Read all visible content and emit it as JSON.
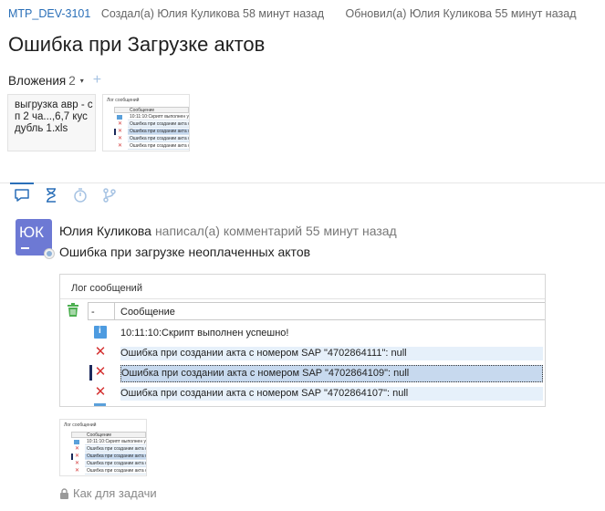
{
  "issue": {
    "key": "MTP_DEV-3101",
    "created": "Создал(а) Юлия Куликова 58 минут назад",
    "updated": "Обновил(а) Юлия Куликова 55 минут назад",
    "title": "Ошибка при Загрузке актов"
  },
  "attachments": {
    "label": "Вложения",
    "count": "2",
    "caret": "▾",
    "add": "+",
    "file_name": "выгрузка авр - сп 2 ча...,6,7 кус дубль 1.xls",
    "mini": {
      "title": "Лог сообщений",
      "col": "Сообщение",
      "rows": [
        "10:11:10:Скрипт выполнен успешно",
        "Ошибка при создании акта с н",
        "Ошибка при создании акта с н",
        "Ошибка при создании акта с н",
        "Ошибка при создании акта с н"
      ]
    }
  },
  "tabs": [
    {
      "name": "comments",
      "icon": "comment-icon"
    },
    {
      "name": "history",
      "icon": "hourglass-icon"
    },
    {
      "name": "worklog",
      "icon": "clock-icon"
    },
    {
      "name": "branches",
      "icon": "branch-icon"
    }
  ],
  "comment": {
    "avatar_initials": "ЮК",
    "author": "Юлия Куликова",
    "action": "написал(а) комментарий 55 минут назад",
    "text": "Ошибка при загрузке неоплаченных актов",
    "log": {
      "title": "Лог сообщений",
      "col1": "-",
      "col2": "Сообщение",
      "rows": [
        {
          "type": "info",
          "text": "10:11:10:Скрипт выполнен успешно!"
        },
        {
          "type": "error",
          "text": "Ошибка при создании акта с номером SAP \"4702864111\": null"
        },
        {
          "type": "error",
          "text": "Ошибка при создании акта с номером SAP \"4702864109\": null"
        },
        {
          "type": "error",
          "text": "Ошибка при создании акта с номером SAP \"4702864107\": null"
        }
      ]
    },
    "visibility": "Как для задачи"
  },
  "colors": {
    "link": "#2a6fb8",
    "avatar": "#6d79d4",
    "error": "#d43131",
    "info": "#4d9be0",
    "selection": "#c7d9ee"
  }
}
